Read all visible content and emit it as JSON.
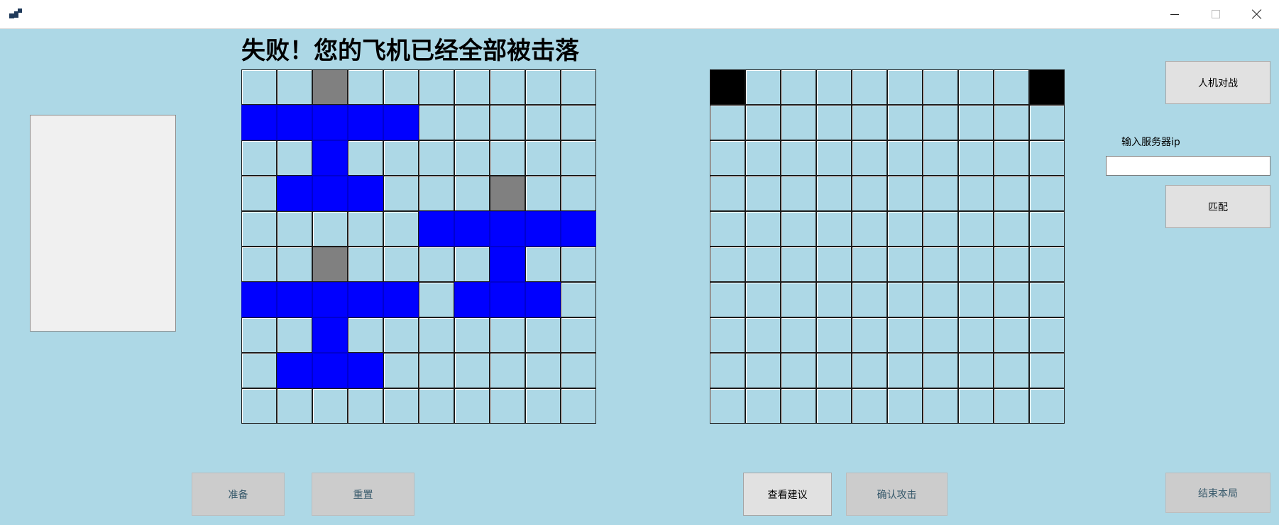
{
  "window": {
    "title": "",
    "icon": "app-icon",
    "controls": {
      "minimize": "minimize-icon",
      "maximize": "maximize-icon",
      "close": "close-icon"
    }
  },
  "status": {
    "message": "失败！您的飞机已经全部被击落"
  },
  "own_board": {
    "rows": [
      [
        "empty",
        "empty",
        "hit",
        "empty",
        "empty",
        "empty",
        "empty",
        "empty",
        "empty",
        "empty"
      ],
      [
        "plane",
        "plane",
        "plane",
        "plane",
        "plane",
        "empty",
        "empty",
        "empty",
        "empty",
        "empty"
      ],
      [
        "empty",
        "empty",
        "plane",
        "empty",
        "empty",
        "empty",
        "empty",
        "empty",
        "empty",
        "empty"
      ],
      [
        "empty",
        "plane",
        "plane",
        "plane",
        "empty",
        "empty",
        "empty",
        "hit",
        "empty",
        "empty"
      ],
      [
        "empty",
        "empty",
        "empty",
        "empty",
        "empty",
        "plane",
        "plane",
        "plane",
        "plane",
        "plane"
      ],
      [
        "empty",
        "empty",
        "hit",
        "empty",
        "empty",
        "empty",
        "empty",
        "plane",
        "empty",
        "empty"
      ],
      [
        "plane",
        "plane",
        "plane",
        "plane",
        "plane",
        "empty",
        "plane",
        "plane",
        "plane",
        "empty"
      ],
      [
        "empty",
        "empty",
        "plane",
        "empty",
        "empty",
        "empty",
        "empty",
        "empty",
        "empty",
        "empty"
      ],
      [
        "empty",
        "plane",
        "plane",
        "plane",
        "empty",
        "empty",
        "empty",
        "empty",
        "empty",
        "empty"
      ],
      [
        "empty",
        "empty",
        "empty",
        "empty",
        "empty",
        "empty",
        "empty",
        "empty",
        "empty",
        "empty"
      ]
    ]
  },
  "enemy_board": {
    "rows": [
      [
        "marked",
        "empty",
        "empty",
        "empty",
        "empty",
        "empty",
        "empty",
        "empty",
        "empty",
        "marked"
      ],
      [
        "empty",
        "empty",
        "empty",
        "empty",
        "empty",
        "empty",
        "empty",
        "empty",
        "empty",
        "empty"
      ],
      [
        "empty",
        "empty",
        "empty",
        "empty",
        "empty",
        "empty",
        "empty",
        "empty",
        "empty",
        "empty"
      ],
      [
        "empty",
        "empty",
        "empty",
        "empty",
        "empty",
        "empty",
        "empty",
        "empty",
        "empty",
        "empty"
      ],
      [
        "empty",
        "empty",
        "empty",
        "empty",
        "empty",
        "empty",
        "empty",
        "empty",
        "empty",
        "empty"
      ],
      [
        "empty",
        "empty",
        "empty",
        "empty",
        "empty",
        "empty",
        "empty",
        "empty",
        "empty",
        "empty"
      ],
      [
        "empty",
        "empty",
        "empty",
        "empty",
        "empty",
        "empty",
        "empty",
        "empty",
        "empty",
        "empty"
      ],
      [
        "empty",
        "empty",
        "empty",
        "empty",
        "empty",
        "empty",
        "empty",
        "empty",
        "empty",
        "empty"
      ],
      [
        "empty",
        "empty",
        "empty",
        "empty",
        "empty",
        "empty",
        "empty",
        "empty",
        "empty",
        "empty"
      ],
      [
        "empty",
        "empty",
        "empty",
        "empty",
        "empty",
        "empty",
        "empty",
        "empty",
        "empty",
        "empty"
      ]
    ]
  },
  "buttons": {
    "vs_ai": "人机对战",
    "match": "匹配",
    "ready": "准备",
    "reset": "重置",
    "view_suggestion": "查看建议",
    "confirm_attack": "确认攻击",
    "end_game": "结束本局"
  },
  "server": {
    "label": "输入服务器ip",
    "value": "",
    "placeholder": ""
  },
  "colors": {
    "background": "#add8e6",
    "plane": "#0000ff",
    "hit": "#808080",
    "marked": "#000000",
    "panel": "#f0f0f0"
  }
}
